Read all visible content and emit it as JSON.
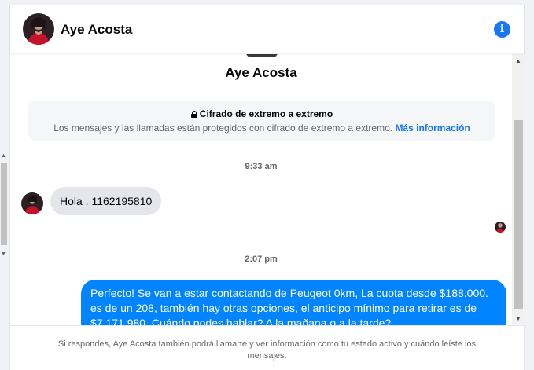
{
  "header": {
    "contact_name": "Aye Acosta",
    "info_icon": "info-icon"
  },
  "profile": {
    "name": "Aye Acosta"
  },
  "encryption": {
    "title": "Cifrado de extremo a extremo",
    "description": "Los mensajes y las llamadas están protegidos con cifrado de extremo a extremo.",
    "link_label": "Más información"
  },
  "messages": [
    {
      "time": "9:33 am",
      "direction": "incoming",
      "text": "Hola . 1162195810"
    },
    {
      "time": "2:07 pm",
      "direction": "outgoing",
      "text": "Perfecto!  Se van a estar contactando de Peugeot 0km, La cuota desde $188.000. es de un 208, también hay otras opciones, el anticipo mínimo para retirar es de $7.171.980. Cuándo podes hablar? A la mañana o a la tarde?"
    }
  ],
  "footer": {
    "notice": "Si respondes, Aye Acosta también podrá llamarte y ver información como tu estado activo y cuándo leíste los mensajes."
  },
  "colors": {
    "accent": "#1877f2",
    "outgoing_bubble": "#0084ff",
    "incoming_bubble": "#e4e6eb",
    "muted_text": "#65676b"
  }
}
